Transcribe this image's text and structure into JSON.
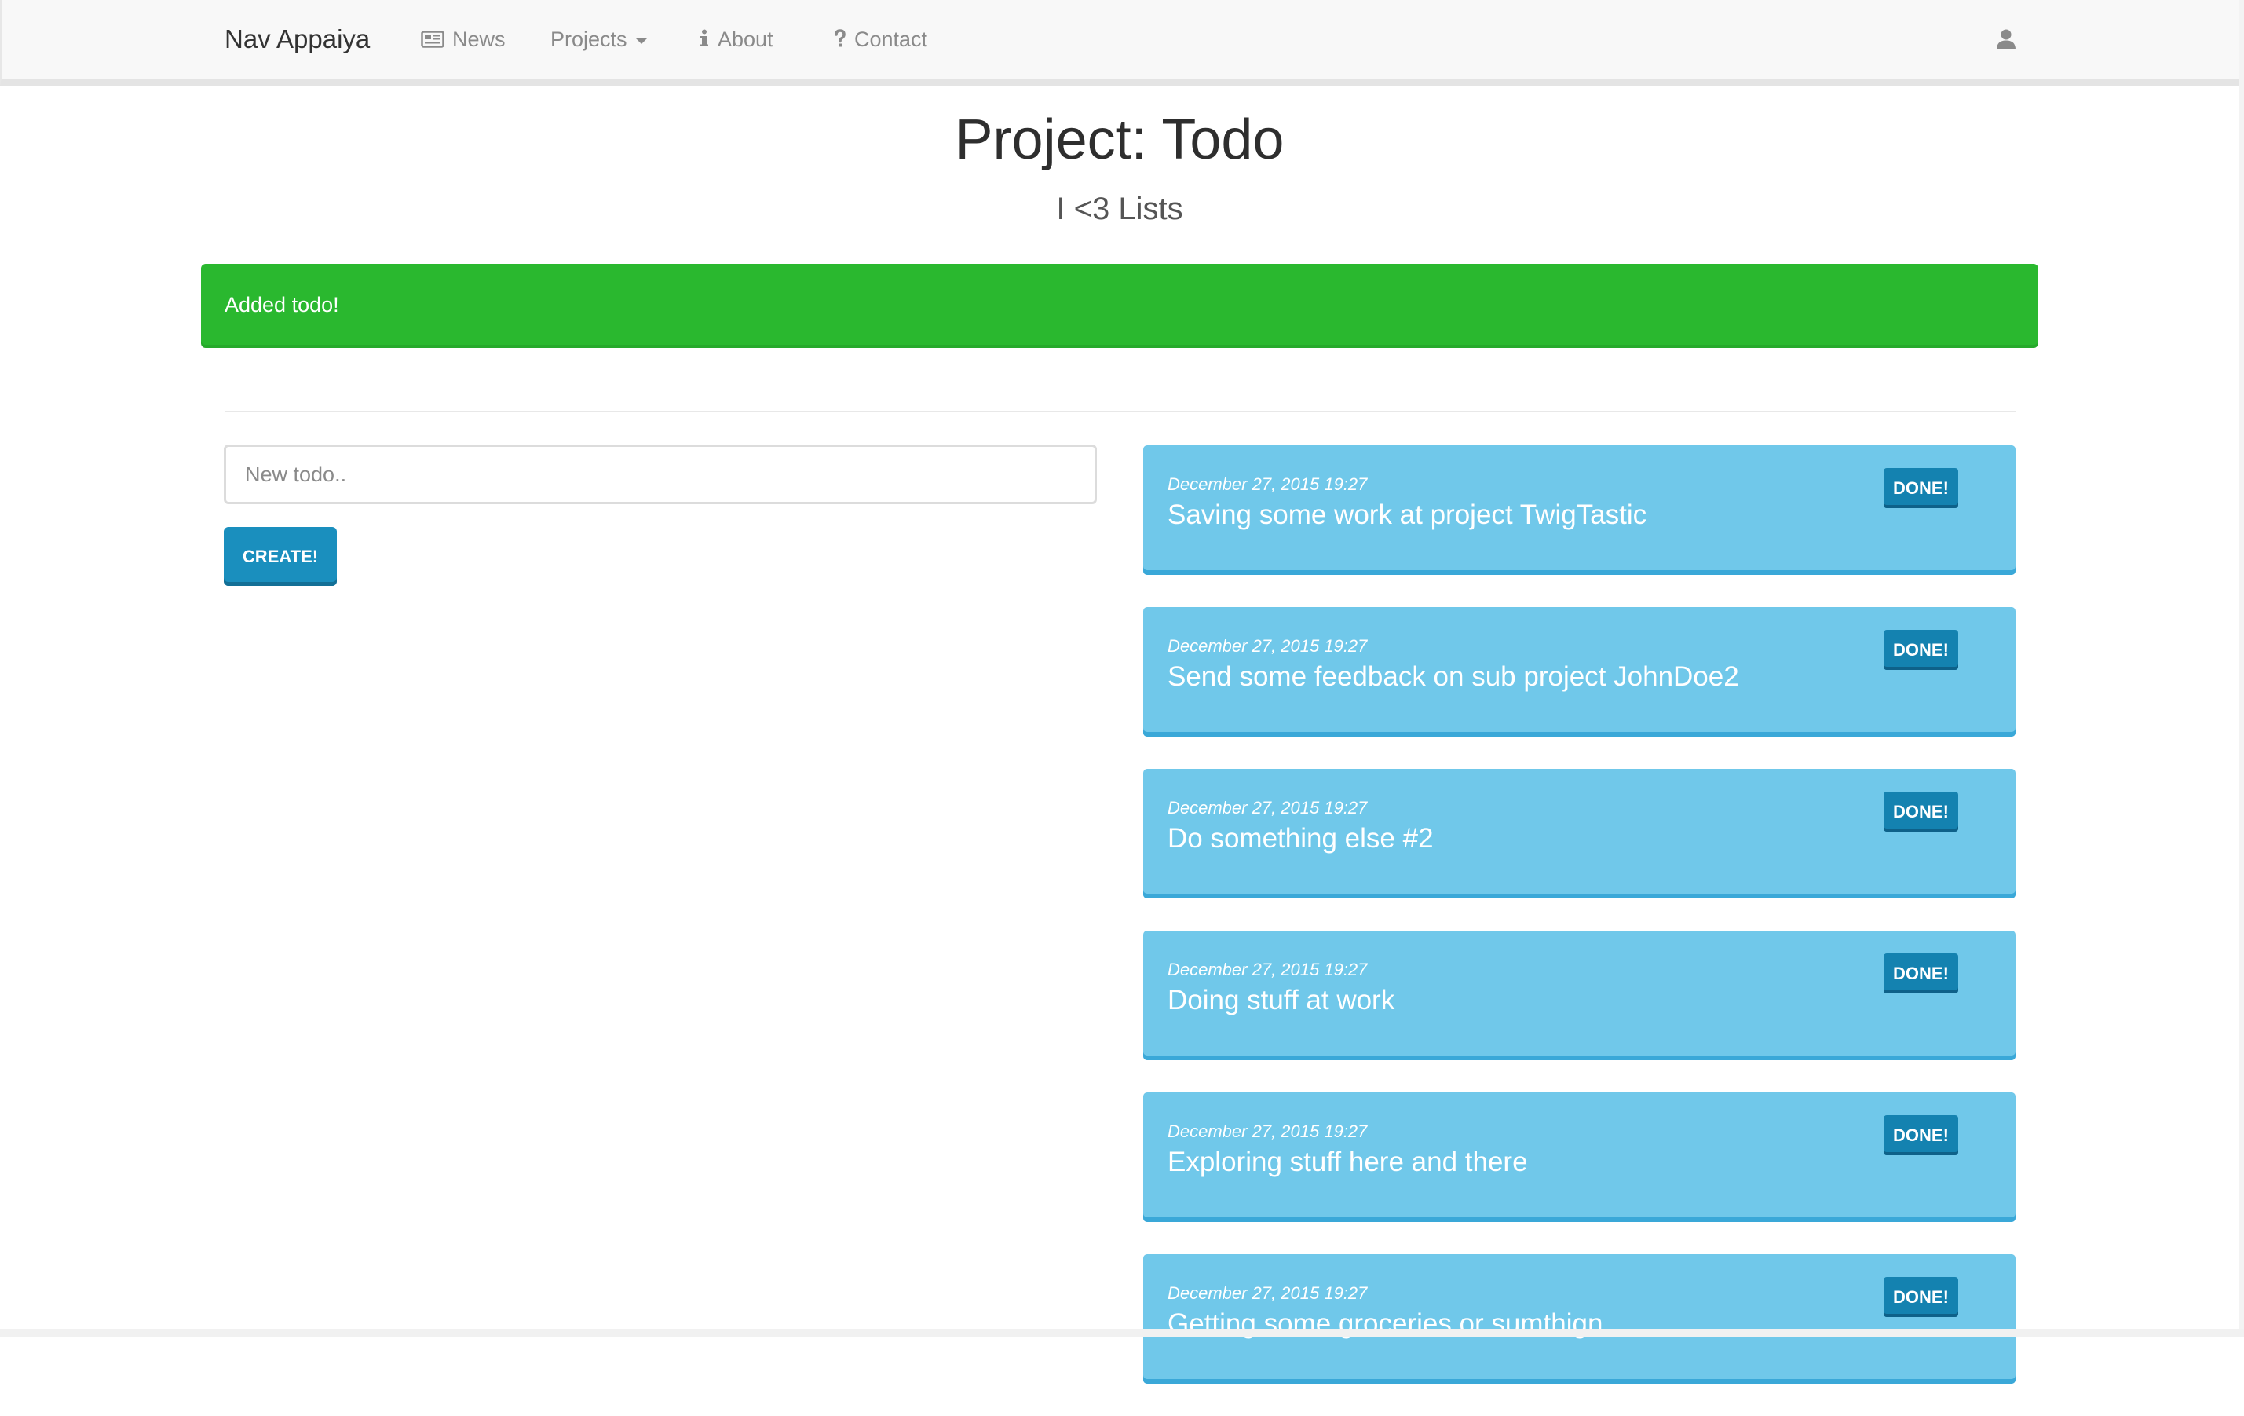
{
  "navbar": {
    "brand": "Nav Appaiya",
    "items": [
      {
        "label": "News",
        "icon": "newspaper-icon"
      },
      {
        "label": "Projects",
        "icon": "dropdown-caret"
      },
      {
        "label": "About",
        "icon": "info-icon"
      },
      {
        "label": "Contact",
        "icon": "question-icon"
      }
    ],
    "user_icon": "user-icon"
  },
  "header": {
    "title": "Project: Todo",
    "subtitle": "I <3 Lists"
  },
  "alert": {
    "text": "Added todo!",
    "color": "#2ab82f"
  },
  "form": {
    "placeholder": "New todo..",
    "value": "",
    "create_label": "CREATE!"
  },
  "todos": [
    {
      "date": "December 27, 2015 19:27",
      "text": "Saving some work at project TwigTastic",
      "done_label": "DONE!"
    },
    {
      "date": "December 27, 2015 19:27",
      "text": "Send some feedback on sub project JohnDoe2",
      "done_label": "DONE!"
    },
    {
      "date": "December 27, 2015 19:27",
      "text": "Do something else #2",
      "done_label": "DONE!"
    },
    {
      "date": "December 27, 2015 19:27",
      "text": "Doing stuff at work",
      "done_label": "DONE!"
    },
    {
      "date": "December 27, 2015 19:27",
      "text": "Exploring stuff here and there",
      "done_label": "DONE!"
    },
    {
      "date": "December 27, 2015 19:27",
      "text": "Getting some groceries or sumthign",
      "done_label": "DONE!"
    }
  ],
  "colors": {
    "card": "#70c8ea",
    "button": "#1a8fbe",
    "done_button": "#1482b0"
  }
}
